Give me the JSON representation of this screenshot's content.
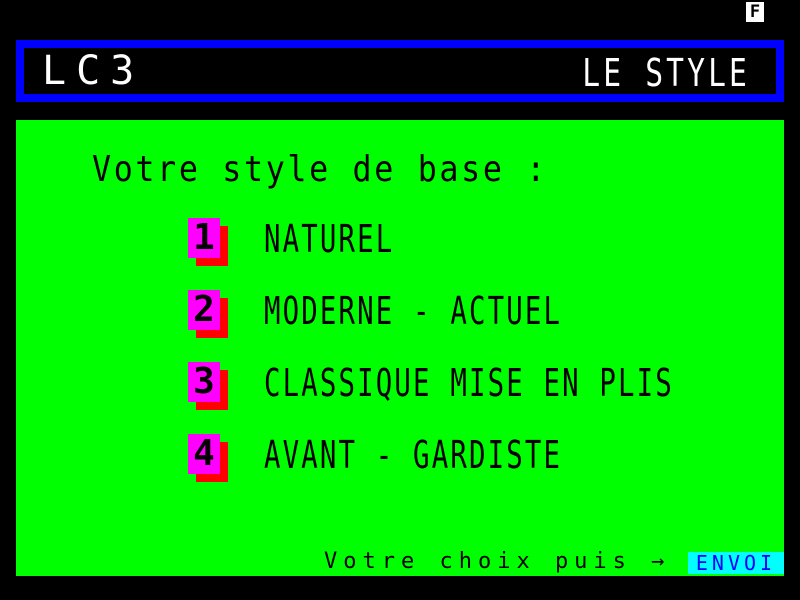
{
  "status": {
    "indicator": "F"
  },
  "header": {
    "brand": "LC3",
    "title": "LE STYLE"
  },
  "menu": {
    "prompt": "Votre style de base :",
    "options": [
      {
        "key": "1",
        "label": "NATUREL"
      },
      {
        "key": "2",
        "label": "MODERNE - ACTUEL"
      },
      {
        "key": "3",
        "label": "CLASSIQUE MISE EN PLIS"
      },
      {
        "key": "4",
        "label": "AVANT - GARDISTE"
      }
    ]
  },
  "footer": {
    "instruction": "Votre choix puis →",
    "send_key": "ENVOI"
  },
  "colors": {
    "panel": "#00ff00",
    "header_border": "#0000ff",
    "key_face": "#ff00ff",
    "key_shadow": "#ff0000",
    "send_key_bg": "#00ffff",
    "send_key_text": "#0000ff"
  }
}
